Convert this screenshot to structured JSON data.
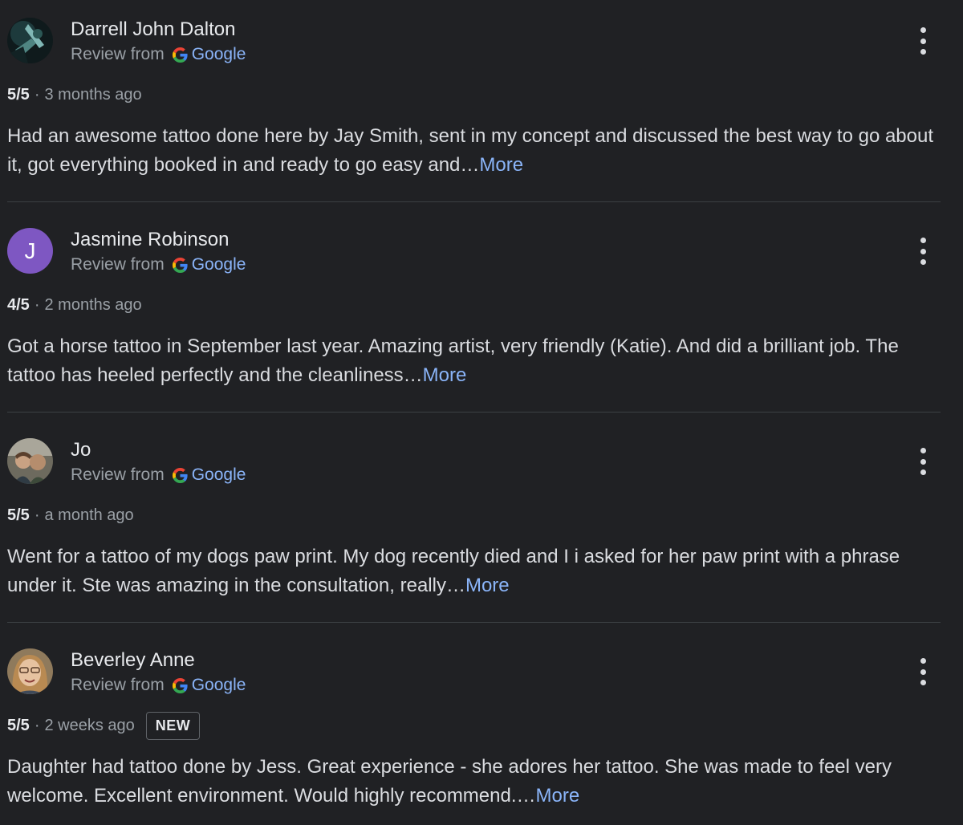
{
  "reviews": [
    {
      "name": "Darrell John Dalton",
      "avatar": "photo-avatar",
      "source_prefix": "Review from",
      "source_brand": "Google",
      "rating": "5/5",
      "separator": "·",
      "date": "3 months ago",
      "badge": "",
      "text": "Had an awesome tattoo done here by Jay Smith, sent in my concept and discussed the best way to go about it, got everything booked in and ready to go easy and…",
      "more": "More"
    },
    {
      "name": "Jasmine Robinson",
      "avatar": "letter-avatar",
      "avatar_letter": "J",
      "avatar_color": "#7e57c2",
      "source_prefix": "Review from",
      "source_brand": "Google",
      "rating": "4/5",
      "separator": "·",
      "date": "2 months ago",
      "badge": "",
      "text": "Got a horse tattoo in September last year. Amazing artist, very friendly (Katie). And did a brilliant job. The tattoo has heeled perfectly and the cleanliness…",
      "more": "More"
    },
    {
      "name": "Jo",
      "avatar": "photo-avatar",
      "source_prefix": "Review from",
      "source_brand": "Google",
      "rating": "5/5",
      "separator": "·",
      "date": "a month ago",
      "badge": "",
      "text": "Went for a tattoo of my dogs paw print. My dog recently died and I i asked for her paw print with a phrase under it. Ste was amazing in the consultation, really…",
      "more": "More"
    },
    {
      "name": "Beverley Anne",
      "avatar": "photo-avatar",
      "source_prefix": "Review from",
      "source_brand": "Google",
      "rating": "5/5",
      "separator": "·",
      "date": "2 weeks ago",
      "badge": "NEW",
      "text": "Daughter had tattoo done by Jess. Great experience - she adores her tattoo. She was made to feel very welcome. Excellent environment. Would highly recommend.…",
      "more": "More"
    }
  ],
  "icons": {
    "source_logo": "google-g-icon",
    "menu": "more-vert-icon"
  },
  "colors": {
    "background": "#202124",
    "link": "#8ab4f8",
    "secondary_text": "#9aa0a6",
    "divider": "#3c4043"
  }
}
